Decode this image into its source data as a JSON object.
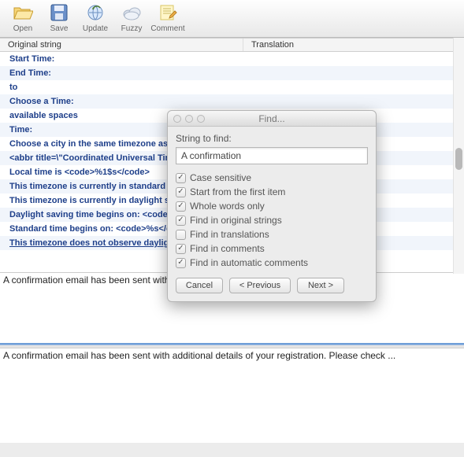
{
  "toolbar": {
    "open": "Open",
    "save": "Save",
    "update": "Update",
    "fuzzy": "Fuzzy",
    "comment": "Comment"
  },
  "columns": {
    "original": "Original string",
    "translation": "Translation"
  },
  "rows": [
    "Start Time:",
    "End Time:",
    " to",
    "Choose a Time:",
    "available spaces",
    "Time:",
    "Choose a city in the same timezone as you.",
    " <abbr title=\\\"Coordinated Universal Time\\\">UTC</abbr>",
    "Local time is <code>%1$s</code>",
    "This timezone is currently in standard time.",
    "This timezone is currently in daylight saving time.",
    "Daylight saving time begins on: <code>%s</code>.",
    "Standard time begins  on: <code>%s</code>.",
    "This timezone does not observe daylight saving time."
  ],
  "pane_top": "A confirmation email has been sent with additional details of your registration.",
  "pane_bot": "A confirmation email has been sent with additional details of your registration. Please check ...",
  "dialog": {
    "title": "Find...",
    "label": "String to find:",
    "value": "A confirmation",
    "opts": {
      "case": "Case sensitive",
      "first": "Start from the first item",
      "whole": "Whole words only",
      "orig": "Find in original strings",
      "trans": "Find in translations",
      "comm": "Find in comments",
      "auto": "Find in automatic comments"
    },
    "checked": {
      "case": true,
      "first": true,
      "whole": true,
      "orig": true,
      "trans": false,
      "comm": true,
      "auto": true
    },
    "buttons": {
      "cancel": "Cancel",
      "prev": "< Previous",
      "next": "Next >"
    }
  }
}
